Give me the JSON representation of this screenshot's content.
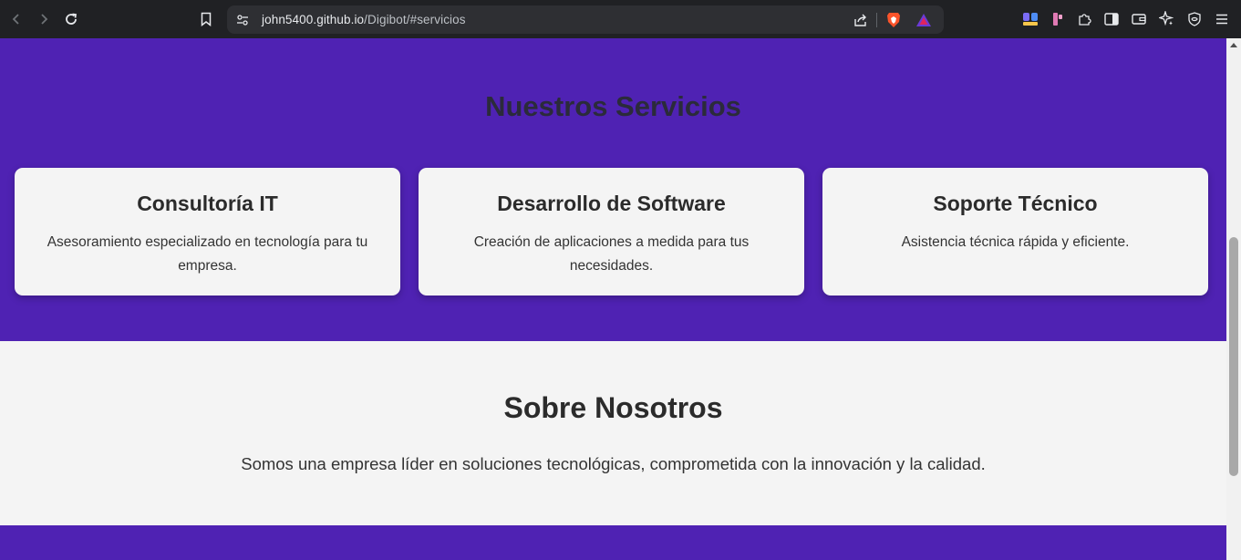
{
  "browser": {
    "url_host": "john5400.github.io",
    "url_path": "/Digibot/#servicios"
  },
  "services": {
    "title": "Nuestros Servicios",
    "cards": [
      {
        "title": "Consultoría IT",
        "text": "Asesoramiento especializado en tecnología para tu empresa."
      },
      {
        "title": "Desarrollo de Software",
        "text": "Creación de aplicaciones a medida para tus necesidades."
      },
      {
        "title": "Soporte Técnico",
        "text": "Asistencia técnica rápida y eficiente."
      }
    ]
  },
  "about": {
    "title": "Sobre Nosotros",
    "text": "Somos una empresa líder en soluciones tecnológicas, comprometida con la innovación y la calidad."
  },
  "colors": {
    "brand_purple": "#4f22b3",
    "card_bg": "#f4f4f4",
    "toolbar_bg": "#202124"
  },
  "icons": {
    "back": "back-arrow-icon",
    "forward": "forward-arrow-icon",
    "reload": "reload-icon",
    "bookmark": "bookmark-icon",
    "site_info": "site-settings-icon",
    "share": "share-icon",
    "brave_shields": "brave-lion-icon",
    "rewards": "brave-rewards-triangle-icon"
  }
}
